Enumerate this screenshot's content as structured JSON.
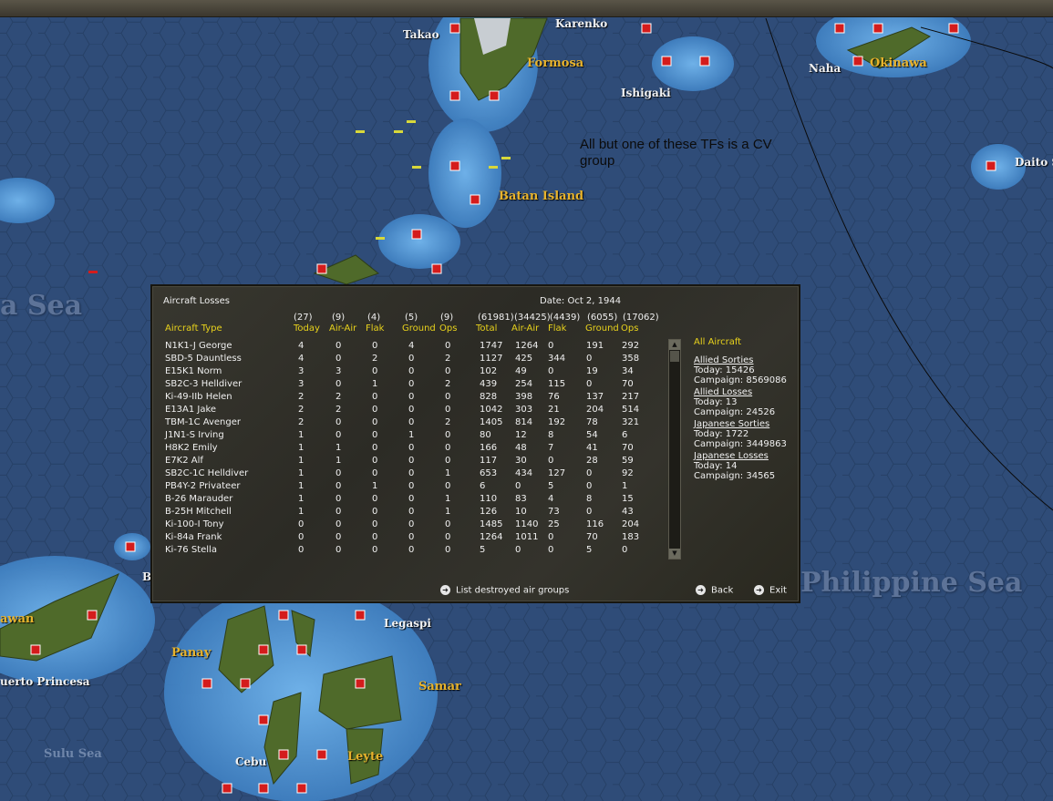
{
  "map": {
    "labels_white": [
      "Takao",
      "Karenko",
      "Naha",
      "Ishigaki",
      "Daito S",
      "Legaspi",
      "uerto Princesa",
      "Cebu",
      "B",
      "awan"
    ],
    "labels_gold": [
      "Formosa",
      "Okinawa",
      "Batan Island",
      "Panay",
      "Samar",
      "Leyte"
    ],
    "labels_sea": [
      "a Sea",
      "Philippine Sea"
    ],
    "labels_small_sea": [
      "Sulu Sea"
    ],
    "annotation": "All but one of these TFs is a CV group",
    "colors": {
      "ocean": "#2f4c78",
      "shallows": "#4a8fd0",
      "land": "#4f6a2a",
      "base_marker": "#d41c1c"
    },
    "icons": [
      "airbase-icon",
      "port-icon",
      "taskforce-icon"
    ]
  },
  "dialog": {
    "title": "Aircraft Losses",
    "date": "Date: Oct 2, 1944",
    "column_totals": [
      "(27)",
      "(9)",
      "(4)",
      "(5)",
      "(9)",
      "(61981)",
      "(34425)",
      "(4439)",
      "(6055)",
      "(17062)"
    ],
    "column_labels": [
      "Aircraft Type",
      "Today",
      "Air-Air",
      "Flak",
      "Ground",
      "Ops",
      "Total",
      "Air-Air",
      "Flak",
      "Ground",
      "Ops"
    ],
    "rows": [
      [
        "N1K1-J George",
        "4",
        "0",
        "0",
        "4",
        "0",
        "1747",
        "1264",
        "0",
        "191",
        "292"
      ],
      [
        "SBD-5 Dauntless",
        "4",
        "0",
        "2",
        "0",
        "2",
        "1127",
        "425",
        "344",
        "0",
        "358"
      ],
      [
        "E15K1 Norm",
        "3",
        "3",
        "0",
        "0",
        "0",
        "102",
        "49",
        "0",
        "19",
        "34"
      ],
      [
        "SB2C-3 Helldiver",
        "3",
        "0",
        "1",
        "0",
        "2",
        "439",
        "254",
        "115",
        "0",
        "70"
      ],
      [
        "Ki-49-IIb Helen",
        "2",
        "2",
        "0",
        "0",
        "0",
        "828",
        "398",
        "76",
        "137",
        "217"
      ],
      [
        "E13A1 Jake",
        "2",
        "2",
        "0",
        "0",
        "0",
        "1042",
        "303",
        "21",
        "204",
        "514"
      ],
      [
        "TBM-1C Avenger",
        "2",
        "0",
        "0",
        "0",
        "2",
        "1405",
        "814",
        "192",
        "78",
        "321"
      ],
      [
        "J1N1-S Irving",
        "1",
        "0",
        "0",
        "1",
        "0",
        "80",
        "12",
        "8",
        "54",
        "6"
      ],
      [
        "H8K2 Emily",
        "1",
        "1",
        "0",
        "0",
        "0",
        "166",
        "48",
        "7",
        "41",
        "70"
      ],
      [
        "E7K2 Alf",
        "1",
        "1",
        "0",
        "0",
        "0",
        "117",
        "30",
        "0",
        "28",
        "59"
      ],
      [
        "SB2C-1C Helldiver",
        "1",
        "0",
        "0",
        "0",
        "1",
        "653",
        "434",
        "127",
        "0",
        "92"
      ],
      [
        "PB4Y-2 Privateer",
        "1",
        "0",
        "1",
        "0",
        "0",
        "6",
        "0",
        "5",
        "0",
        "1"
      ],
      [
        "B-26 Marauder",
        "1",
        "0",
        "0",
        "0",
        "1",
        "110",
        "83",
        "4",
        "8",
        "15"
      ],
      [
        "B-25H Mitchell",
        "1",
        "0",
        "0",
        "0",
        "1",
        "126",
        "10",
        "73",
        "0",
        "43"
      ],
      [
        "Ki-100-I Tony",
        "0",
        "0",
        "0",
        "0",
        "0",
        "1485",
        "1140",
        "25",
        "116",
        "204"
      ],
      [
        "Ki-84a Frank",
        "0",
        "0",
        "0",
        "0",
        "0",
        "1264",
        "1011",
        "0",
        "70",
        "183"
      ],
      [
        "Ki-76 Stella",
        "0",
        "0",
        "0",
        "0",
        "0",
        "5",
        "0",
        "0",
        "5",
        "0"
      ]
    ],
    "side": {
      "filter": "All Aircraft",
      "allied_sorties": {
        "title": "Allied Sorties",
        "today": "Today:  15426",
        "campaign": "Campaign: 8569086"
      },
      "allied_losses": {
        "title": "Allied Losses",
        "today": "Today:  13",
        "campaign": "Campaign: 24526"
      },
      "japanese_sorties": {
        "title": "Japanese Sorties",
        "today": "Today:  1722",
        "campaign": "Campaign: 3449863"
      },
      "japanese_losses": {
        "title": "Japanese Losses",
        "today": "Today:  14",
        "campaign": "Campaign: 34565"
      }
    },
    "footer": {
      "list_destroyed": "List destroyed air groups",
      "back": "Back",
      "exit": "Exit"
    }
  }
}
